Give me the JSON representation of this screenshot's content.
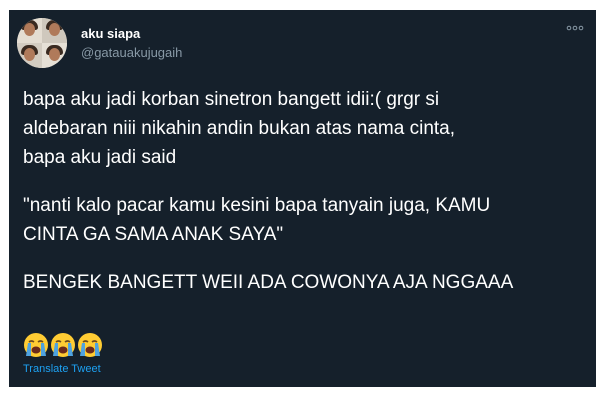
{
  "tweet": {
    "display_name": "aku siapa",
    "handle": "@gatauakujugaih",
    "paragraph_1_line_1": "bapa aku jadi korban sinetron bangett idii:( grgr si",
    "paragraph_1_line_2": "aldebaran niii nikahin andin bukan atas nama cinta,",
    "paragraph_1_line_3": "bapa aku jadi said",
    "paragraph_2_line_1": "\"nanti kalo pacar kamu kesini bapa tanyain juga, KAMU",
    "paragraph_2_line_2": "CINTA GA SAMA ANAK SAYA\"",
    "paragraph_3_line_1": "BENGEK BANGETT WEII ADA COWONYA AJA NGGAAA",
    "emojis": [
      "loudly-crying-face",
      "loudly-crying-face",
      "loudly-crying-face"
    ],
    "translate_label": "Translate Tweet"
  },
  "colors": {
    "background": "#15202b",
    "text": "#ffffff",
    "secondary_text": "#8899a6",
    "link": "#1da1f2",
    "emoji_face": "#ffcc33",
    "emoji_tears": "#4fa3e0"
  }
}
